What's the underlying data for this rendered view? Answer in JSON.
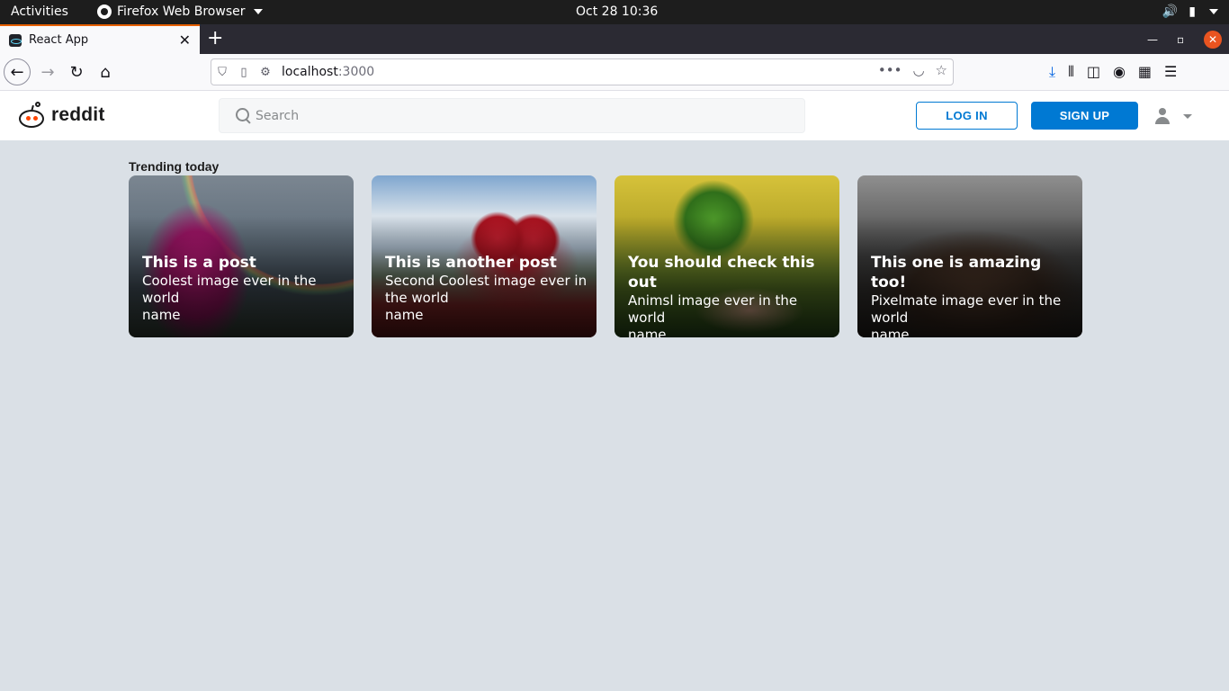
{
  "os_bar": {
    "activities": "Activities",
    "app_name": "Firefox Web Browser",
    "clock": "Oct 28  10:36"
  },
  "browser": {
    "tab_title": "React App",
    "url_host": "localhost",
    "url_port": ":3000"
  },
  "header": {
    "brand": "reddit",
    "search_placeholder": "Search",
    "login_label": "LOG IN",
    "signup_label": "SIGN UP"
  },
  "trending": {
    "heading": "Trending today",
    "cards": [
      {
        "title": "This is a post",
        "subtitle": "Coolest image ever in the world",
        "name": "name"
      },
      {
        "title": "This is another post",
        "subtitle": "Second Coolest image ever in the world",
        "name": "name"
      },
      {
        "title": "You should check this out",
        "subtitle": "Animsl image ever in the world",
        "name": "name"
      },
      {
        "title": "This one is amazing too!",
        "subtitle": "Pixelmate image ever in the world",
        "name": "name"
      }
    ]
  }
}
